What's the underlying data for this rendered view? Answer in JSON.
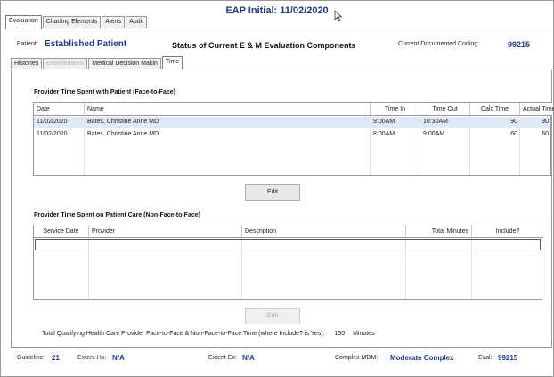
{
  "window": {
    "title": "EAP Initial: 11/02/2020"
  },
  "top_tabs": [
    "Evaluation",
    "Charting Elements",
    "Alerts",
    "Audit"
  ],
  "header": {
    "patient_label": "Patient:",
    "patient_name": "Established Patient",
    "status_title": "Status of Current E & M Evaluation Components",
    "coding_label": "Current Documented Coding:",
    "coding_value": "99215"
  },
  "sub_tabs": [
    "Histories",
    "Examinations",
    "Medical Decision Makin",
    "Time"
  ],
  "face_to_face": {
    "title": "Provider Time Spent with Patient (Face-to-Face)",
    "columns": [
      "Date",
      "Name",
      "Time In",
      "Time Out",
      "Calc Time",
      "Actual Time"
    ],
    "rows": [
      {
        "date": "11/02/2020",
        "name": "Bates, Christine Anne MD",
        "time_in": "9:00AM",
        "time_out": "10:30AM",
        "calc_time": "90",
        "actual_time": "90"
      },
      {
        "date": "11/02/2020",
        "name": "Bates, Christine Anne MD",
        "time_in": "8:00AM",
        "time_out": "9:00AM",
        "calc_time": "60",
        "actual_time": "60"
      }
    ],
    "edit_label": "Edit"
  },
  "non_face_to_face": {
    "title": "Provider Time Spent on Patient Care (Non-Face-to-Face)",
    "columns": [
      "Service Date",
      "Provider",
      "Description",
      "Total Minutes",
      "Include?"
    ],
    "edit_label": "Edit"
  },
  "total": {
    "label": "Total Qualifying Health Care Provider Face-to-Face & Non-Face-to-Face Time (where Include? is Yes):",
    "value": "150",
    "unit": "Minutes"
  },
  "footer": {
    "guideline_label": "Guideline:",
    "guideline_value": "21",
    "extent_hx_label": "Extent Hx:",
    "extent_hx_value": "N/A",
    "extent_ex_label": "Extent Ex:",
    "extent_ex_value": "N/A",
    "complex_mdm_label": "Complex MDM:",
    "complex_mdm_value": "Moderate Complex",
    "eval_label": "Eval:",
    "eval_value": "99215"
  }
}
